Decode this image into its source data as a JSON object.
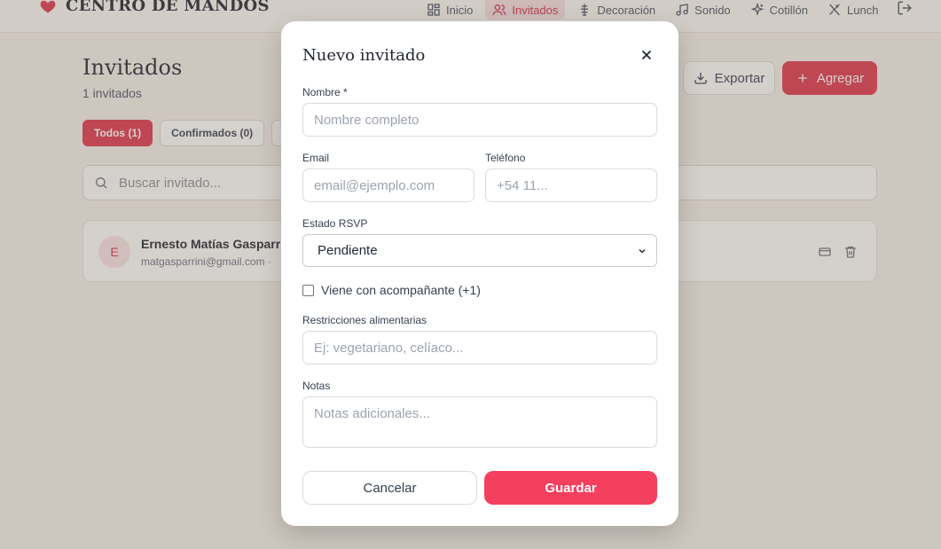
{
  "brand": {
    "title": "CENTRO DE MANDOS"
  },
  "nav": {
    "items": [
      {
        "label": "Inicio",
        "icon": "grid-icon"
      },
      {
        "label": "Invitados",
        "icon": "users-icon",
        "active": true
      },
      {
        "label": "Decoración",
        "icon": "decoration-icon"
      },
      {
        "label": "Sonido",
        "icon": "music-icon"
      },
      {
        "label": "Cotillón",
        "icon": "sparkles-icon"
      },
      {
        "label": "Lunch",
        "icon": "utensils-icon"
      }
    ],
    "logout_icon": "logout-icon"
  },
  "page": {
    "title": "Invitados",
    "subtitle": "1 invitados",
    "export_label": "Exportar",
    "add_label": "Agregar"
  },
  "filters": [
    {
      "label": "Todos (1)",
      "active": true
    },
    {
      "label": "Confirmados (0)"
    }
  ],
  "search": {
    "placeholder": "Buscar invitado..."
  },
  "guests": [
    {
      "initial": "E",
      "name": "Ernesto Matías Gasparri",
      "email": "matgasparrini@gmail.com ·"
    }
  ],
  "modal": {
    "title": "Nuevo invitado",
    "name_label": "Nombre *",
    "name_placeholder": "Nombre completo",
    "email_label": "Email",
    "email_placeholder": "email@ejemplo.com",
    "phone_label": "Teléfono",
    "phone_placeholder": "+54 11...",
    "rsvp_label": "Estado RSVP",
    "rsvp_value": "Pendiente",
    "companion_label": "Viene con acompañante (+1)",
    "diet_label": "Restricciones alimentarias",
    "diet_placeholder": "Ej: vegetariano, celíaco...",
    "notes_label": "Notas",
    "notes_placeholder": "Notas adicionales...",
    "cancel_label": "Cancelar",
    "save_label": "Guardar"
  },
  "colors": {
    "accent": "#e0354f",
    "save_button": "#f43f5e",
    "nav_active_bg": "#f7dfe2"
  }
}
